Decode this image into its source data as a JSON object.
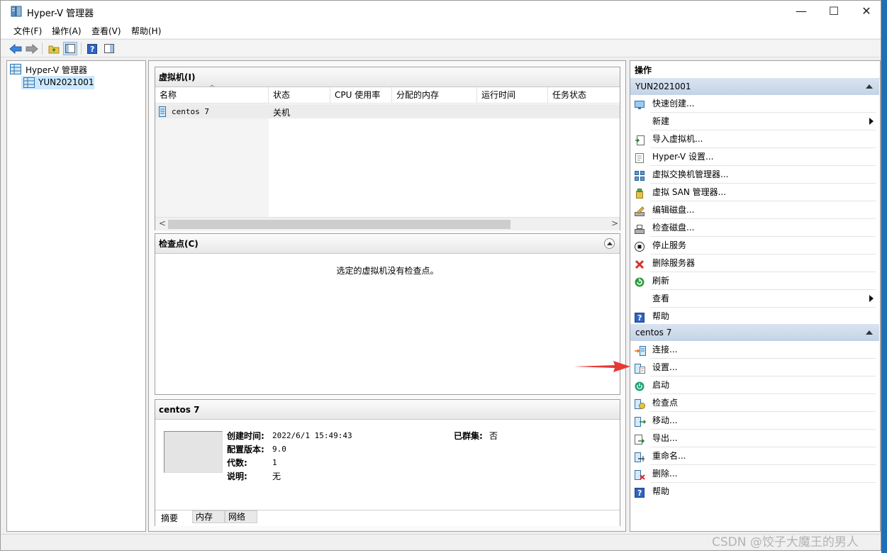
{
  "window": {
    "title": "Hyper-V 管理器",
    "minimize": "—",
    "maximize": "☐",
    "close": "✕"
  },
  "menu": [
    "文件(F)",
    "操作(A)",
    "查看(V)",
    "帮助(H)"
  ],
  "tree": {
    "root": "Hyper-V 管理器",
    "server": "YUN2021001"
  },
  "vm_panel": {
    "title": "虚拟机(I)",
    "sort_indicator": "^",
    "columns": [
      "名称",
      "状态",
      "CPU 使用率",
      "分配的内存",
      "运行时间",
      "任务状态"
    ],
    "rows": [
      {
        "name": "centos 7",
        "state": "关机",
        "cpu": "",
        "memory": "",
        "uptime": "",
        "task": ""
      }
    ],
    "scroll_left": "<",
    "scroll_right": ">"
  },
  "checkpoint_panel": {
    "title": "检查点(C)",
    "empty_text": "选定的虚拟机没有检查点。"
  },
  "details": {
    "title": "centos 7",
    "fields": [
      {
        "label": "创建时间:",
        "value": "2022/6/1 15:49:43"
      },
      {
        "label": "配置版本:",
        "value": "9.0"
      },
      {
        "label": "代数:",
        "value": "1"
      },
      {
        "label": "说明:",
        "value": "无"
      }
    ],
    "clustered_label": "已群集:",
    "clustered_value": "否",
    "tabs": [
      "摘要",
      "内存",
      "网络"
    ]
  },
  "actions": {
    "title": "操作",
    "server_group": {
      "name": "YUN2021001",
      "items": [
        {
          "label": "快速创建...",
          "icon": "monitor-icon"
        },
        {
          "label": "新建",
          "icon": "none",
          "submenu": true
        },
        {
          "label": "导入虚拟机...",
          "icon": "import-icon"
        },
        {
          "label": "Hyper-V 设置...",
          "icon": "settings-doc-icon"
        },
        {
          "label": "虚拟交换机管理器...",
          "icon": "switch-icon"
        },
        {
          "label": "虚拟 SAN 管理器...",
          "icon": "san-icon"
        },
        {
          "label": "编辑磁盘...",
          "icon": "edit-disk-icon"
        },
        {
          "label": "检查磁盘...",
          "icon": "inspect-disk-icon"
        },
        {
          "label": "停止服务",
          "icon": "stop-icon"
        },
        {
          "label": "删除服务器",
          "icon": "red-x-icon"
        },
        {
          "label": "刷新",
          "icon": "refresh-icon"
        },
        {
          "label": "查看",
          "icon": "none",
          "submenu": true
        },
        {
          "label": "帮助",
          "icon": "help-icon"
        }
      ]
    },
    "vm_group": {
      "name": "centos 7",
      "items": [
        {
          "label": "连接...",
          "icon": "connect-icon"
        },
        {
          "label": "设置...",
          "icon": "vm-settings-icon"
        },
        {
          "label": "启动",
          "icon": "power-icon"
        },
        {
          "label": "检查点",
          "icon": "checkpoint-icon"
        },
        {
          "label": "移动...",
          "icon": "move-icon"
        },
        {
          "label": "导出...",
          "icon": "export-icon"
        },
        {
          "label": "重命名...",
          "icon": "rename-icon"
        },
        {
          "label": "删除...",
          "icon": "delete-vm-icon"
        },
        {
          "label": "帮助",
          "icon": "help-icon"
        }
      ]
    }
  },
  "watermark": "CSDN @饺子大魔王的男人",
  "colors": {
    "accent_red": "#e53935",
    "group_header": "#c9d8ea",
    "selection": "#cce8ff"
  }
}
